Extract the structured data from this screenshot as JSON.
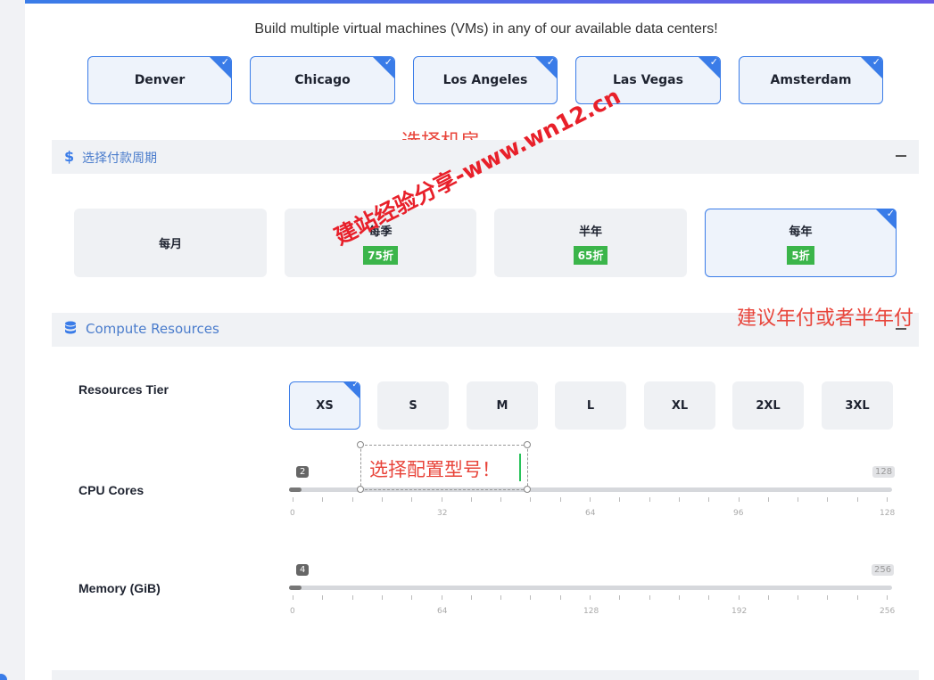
{
  "intro_text": "Build multiple virtual machines (VMs) in any of our available data centers!",
  "datacenters": [
    {
      "label": "Denver",
      "selected": true
    },
    {
      "label": "Chicago",
      "selected": true
    },
    {
      "label": "Los Angeles",
      "selected": true
    },
    {
      "label": "Las Vegas",
      "selected": true
    },
    {
      "label": "Amsterdam",
      "selected": true
    }
  ],
  "annotations": {
    "select_datacenter": "选择机房",
    "recommend_billing": "建议年付或者半年付",
    "select_model": "选择配置型号！",
    "watermark": "建站经验分享-www.wn12.cn"
  },
  "billing_section": {
    "title": "选择付款周期",
    "icon": "dollar-icon",
    "options": [
      {
        "label": "每月",
        "discount": "",
        "selected": false
      },
      {
        "label": "每季",
        "discount": "75折",
        "selected": false
      },
      {
        "label": "半年",
        "discount": "65折",
        "selected": false
      },
      {
        "label": "每年",
        "discount": "5折",
        "selected": true
      }
    ]
  },
  "compute_section": {
    "title": "Compute Resources",
    "icon": "database-icon",
    "tier_label": "Resources Tier",
    "tiers": [
      "XS",
      "S",
      "M",
      "L",
      "XL",
      "2XL",
      "3XL"
    ],
    "selected_tier": "XS",
    "cpu": {
      "label": "CPU Cores",
      "value": "2",
      "max": "128",
      "ticks": [
        "0",
        "32",
        "64",
        "96",
        "128"
      ]
    },
    "memory": {
      "label": "Memory (GiB)",
      "value": "4",
      "max": "256",
      "ticks": [
        "0",
        "64",
        "128",
        "192",
        "256"
      ]
    }
  },
  "colors": {
    "accent": "#3a7ce8",
    "discount": "#3bb54a",
    "annotation": "#e8443a"
  }
}
